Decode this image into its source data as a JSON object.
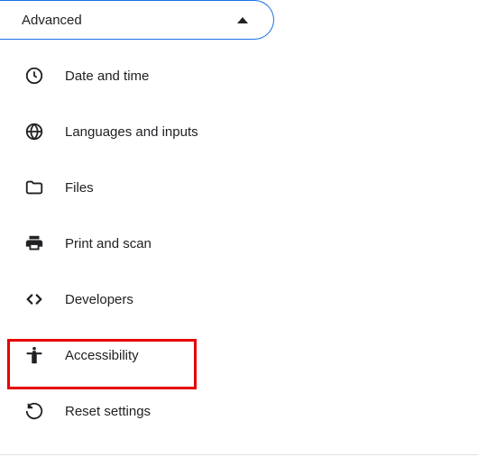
{
  "header": {
    "label": "Advanced"
  },
  "items": [
    {
      "icon": "clock-icon",
      "label": "Date and time"
    },
    {
      "icon": "globe-icon",
      "label": "Languages and inputs"
    },
    {
      "icon": "folder-icon",
      "label": "Files"
    },
    {
      "icon": "printer-icon",
      "label": "Print and scan"
    },
    {
      "icon": "code-icon",
      "label": "Developers"
    },
    {
      "icon": "accessibility-icon",
      "label": "Accessibility"
    },
    {
      "icon": "reset-icon",
      "label": "Reset settings"
    }
  ]
}
